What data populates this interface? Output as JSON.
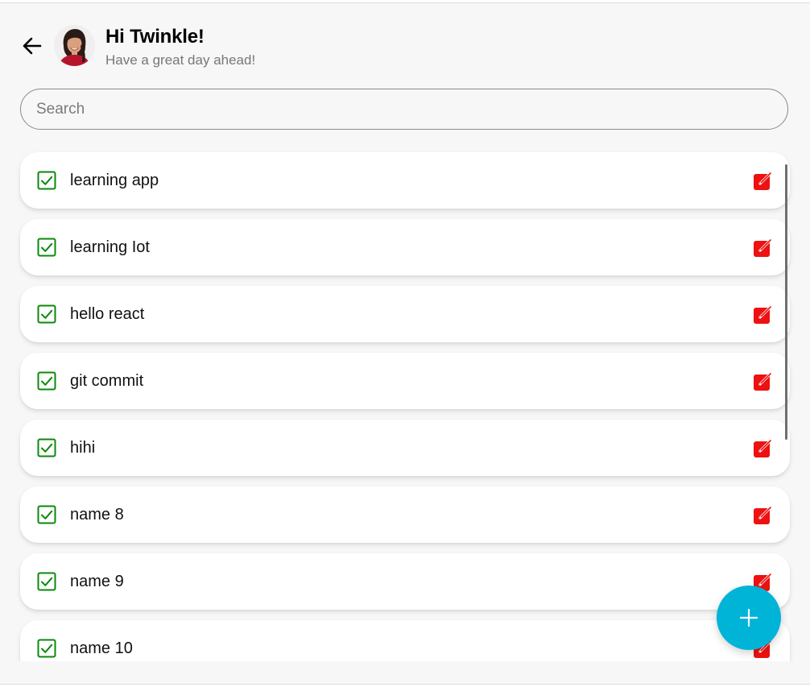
{
  "header": {
    "greeting": "Hi Twinkle!",
    "subtitle": "Have a great day ahead!",
    "back_icon": "arrow-left-icon",
    "avatar": "user-avatar"
  },
  "search": {
    "placeholder": "Search",
    "value": ""
  },
  "todos": [
    {
      "label": "learning app",
      "checked": true
    },
    {
      "label": "learning Iot",
      "checked": true
    },
    {
      "label": "hello react",
      "checked": true
    },
    {
      "label": "git commit",
      "checked": true
    },
    {
      "label": "hihi",
      "checked": true
    },
    {
      "label": "name 8",
      "checked": true
    },
    {
      "label": "name 9",
      "checked": true
    },
    {
      "label": "name 10",
      "checked": true
    }
  ],
  "icons": {
    "checkbox": "checkbox-checked-icon",
    "edit": "edit-icon",
    "add": "plus-icon"
  },
  "colors": {
    "check_green": "#0a8a0a",
    "edit_red": "#ee1111",
    "fab_cyan": "#00b4d8",
    "background": "#f7f7f7"
  }
}
